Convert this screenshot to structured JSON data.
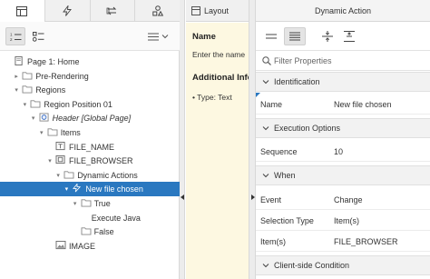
{
  "left_tabs": [
    {
      "icon": "rendering-tree-icon",
      "active": true
    },
    {
      "icon": "dynamic-actions-bolt-icon",
      "active": false
    },
    {
      "icon": "processing-cycle-icon",
      "active": false
    },
    {
      "icon": "shared-components-shapes-icon",
      "active": false
    }
  ],
  "tree": [
    {
      "label": "Page 1: Home",
      "level": 0,
      "toggle": "",
      "icon": "page-icon"
    },
    {
      "label": "Pre-Rendering",
      "level": 1,
      "toggle": "▸",
      "icon": "folder-icon"
    },
    {
      "label": "Regions",
      "level": 1,
      "toggle": "▾",
      "icon": "folder-icon"
    },
    {
      "label": "Region Position 01",
      "level": 2,
      "toggle": "▾",
      "icon": "folder-icon"
    },
    {
      "label": "Header [Global Page]",
      "level": 3,
      "toggle": "▾",
      "icon": "global-region-icon",
      "italic": true
    },
    {
      "label": "Items",
      "level": 4,
      "toggle": "▾",
      "icon": "folder-icon"
    },
    {
      "label": "FILE_NAME",
      "level": 5,
      "toggle": "",
      "icon": "text-item-icon"
    },
    {
      "label": "FILE_BROWSER",
      "level": 5,
      "toggle": "▾",
      "icon": "file-browse-item-icon"
    },
    {
      "label": "Dynamic Actions",
      "level": 6,
      "toggle": "▾",
      "icon": "folder-icon"
    },
    {
      "label": "New file chosen",
      "level": 7,
      "toggle": "▾",
      "icon": "lightning-icon",
      "selected": true
    },
    {
      "label": "True",
      "level": 8,
      "toggle": "▾",
      "icon": "folder-icon"
    },
    {
      "label": "Execute Java",
      "level": 9,
      "toggle": "",
      "icon": ""
    },
    {
      "label": "False",
      "level": 8,
      "toggle": "",
      "icon": "folder-icon"
    },
    {
      "label": "IMAGE",
      "level": 5,
      "toggle": "",
      "icon": "image-item-icon"
    }
  ],
  "middle": {
    "tab_label": "Layout",
    "heading1": "Name",
    "text1": "Enter the name",
    "heading2": "Additional Info",
    "bullet": "• Type: Text"
  },
  "right": {
    "title": "Dynamic Action",
    "filter_placeholder": "Filter Properties",
    "sections": {
      "identification": "Identification",
      "execution_options": "Execution Options",
      "when": "When",
      "client_side_condition": "Client-side Condition"
    },
    "props": {
      "name_label": "Name",
      "name_value": "New file chosen",
      "sequence_label": "Sequence",
      "sequence_value": "10",
      "event_label": "Event",
      "event_value": "Change",
      "selection_type_label": "Selection Type",
      "selection_type_value": "Item(s)",
      "items_label": "Item(s)",
      "items_value": "FILE_BROWSER"
    }
  },
  "colors": {
    "selected_row": "#2a78c0",
    "help_background": "#fdf8e1",
    "section_background": "#f2f2f2"
  }
}
